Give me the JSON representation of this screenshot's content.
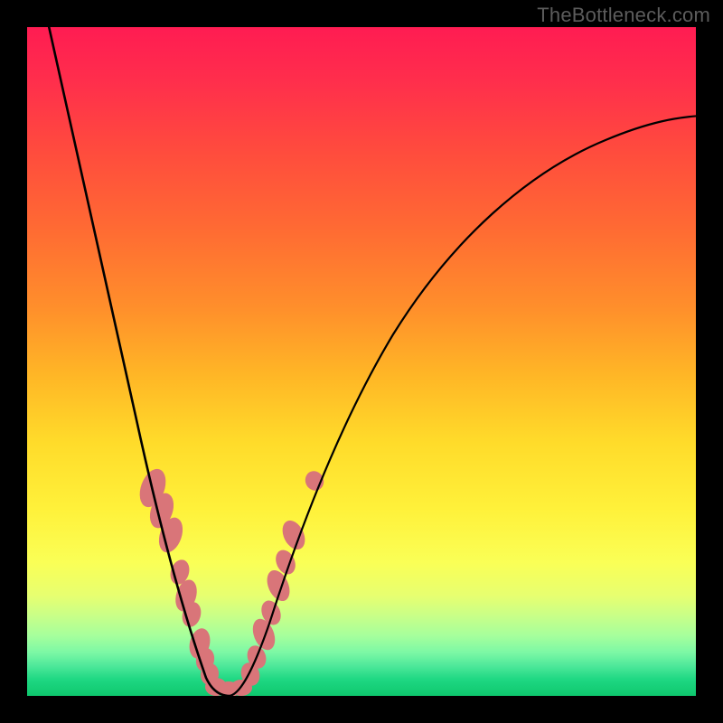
{
  "watermark": "TheBottleneck.com",
  "colors": {
    "frame_bg": "#000000",
    "curve_stroke": "#000000",
    "blob_fill": "#d97579",
    "watermark_text": "#5c5c5c",
    "gradient_stops": [
      "#ff1c52",
      "#ff2e4c",
      "#ff4a3e",
      "#ff6a33",
      "#ff8f2b",
      "#ffb626",
      "#ffdb2a",
      "#fff13a",
      "#faff56",
      "#e7ff70",
      "#c9ff88",
      "#a6ff9c",
      "#7cf8a5",
      "#4ee89a",
      "#1fd883",
      "#0ec76d"
    ]
  },
  "chart_data": {
    "type": "line",
    "title": "",
    "xlabel": "",
    "ylabel": "",
    "xlim": [
      0,
      100
    ],
    "ylim": [
      0,
      100
    ],
    "series": [
      {
        "name": "left-curve",
        "x": [
          3,
          6,
          9,
          12,
          15,
          17,
          20,
          22,
          24,
          26,
          28
        ],
        "values": [
          100,
          86,
          72,
          58,
          45,
          34,
          23,
          14,
          7,
          2,
          0
        ]
      },
      {
        "name": "right-curve",
        "x": [
          28,
          31,
          35,
          40,
          46,
          53,
          61,
          70,
          80,
          90,
          100
        ],
        "values": [
          0,
          6,
          15,
          27,
          39,
          51,
          62,
          71,
          78,
          83,
          86
        ]
      }
    ],
    "annotations": {
      "markers": [
        {
          "name": "left-cluster-upper",
          "x_range": [
            17,
            20
          ],
          "y_range": [
            22,
            34
          ]
        },
        {
          "name": "left-cluster-mid",
          "x_range": [
            20,
            24
          ],
          "y_range": [
            8,
            22
          ]
        },
        {
          "name": "left-cluster-lower",
          "x_range": [
            24,
            28
          ],
          "y_range": [
            0,
            8
          ]
        },
        {
          "name": "valley-bottom",
          "x_range": [
            26,
            30
          ],
          "y_range": [
            0,
            2
          ]
        },
        {
          "name": "right-cluster-lower",
          "x_range": [
            30,
            33
          ],
          "y_range": [
            3,
            13
          ]
        },
        {
          "name": "right-cluster-mid",
          "x_range": [
            33,
            36
          ],
          "y_range": [
            14,
            22
          ]
        },
        {
          "name": "right-marker-upper",
          "x_range": [
            38,
            40
          ],
          "y_range": [
            28,
            32
          ]
        }
      ]
    }
  }
}
